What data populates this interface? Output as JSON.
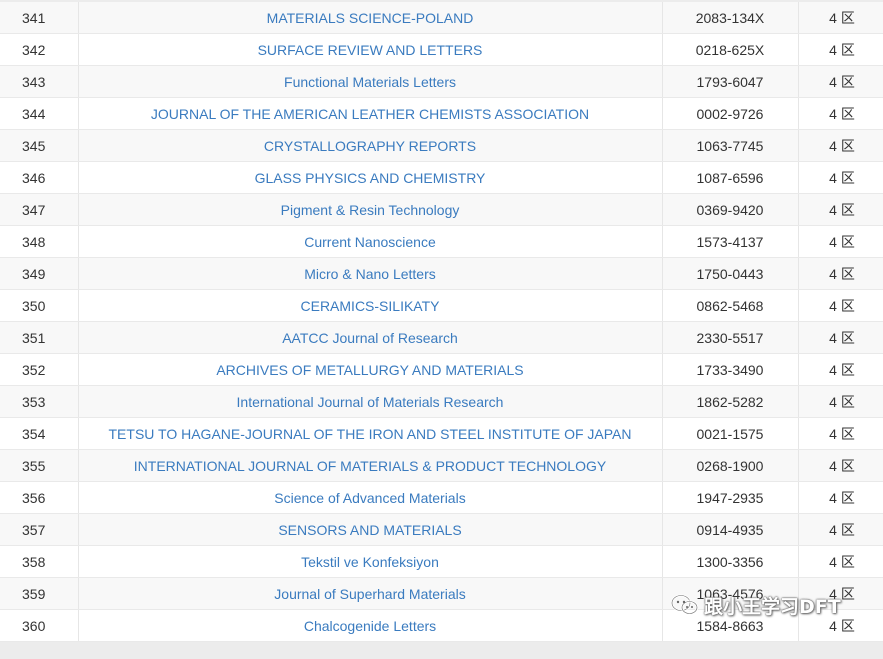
{
  "columns": [
    "",
    "",
    "",
    ""
  ],
  "rows": [
    {
      "num": "341",
      "title": "MATERIALS SCIENCE-POLAND",
      "issn": "2083-134X",
      "zone": "4 区"
    },
    {
      "num": "342",
      "title": "SURFACE REVIEW AND LETTERS",
      "issn": "0218-625X",
      "zone": "4 区"
    },
    {
      "num": "343",
      "title": "Functional Materials Letters",
      "issn": "1793-6047",
      "zone": "4 区"
    },
    {
      "num": "344",
      "title": "JOURNAL OF THE AMERICAN LEATHER CHEMISTS ASSOCIATION",
      "issn": "0002-9726",
      "zone": "4 区"
    },
    {
      "num": "345",
      "title": "CRYSTALLOGRAPHY REPORTS",
      "issn": "1063-7745",
      "zone": "4 区"
    },
    {
      "num": "346",
      "title": "GLASS PHYSICS AND CHEMISTRY",
      "issn": "1087-6596",
      "zone": "4 区"
    },
    {
      "num": "347",
      "title": "Pigment & Resin Technology",
      "issn": "0369-9420",
      "zone": "4 区"
    },
    {
      "num": "348",
      "title": "Current Nanoscience",
      "issn": "1573-4137",
      "zone": "4 区"
    },
    {
      "num": "349",
      "title": "Micro & Nano Letters",
      "issn": "1750-0443",
      "zone": "4 区"
    },
    {
      "num": "350",
      "title": "CERAMICS-SILIKATY",
      "issn": "0862-5468",
      "zone": "4 区"
    },
    {
      "num": "351",
      "title": "AATCC Journal of Research",
      "issn": "2330-5517",
      "zone": "4 区"
    },
    {
      "num": "352",
      "title": "ARCHIVES OF METALLURGY AND MATERIALS",
      "issn": "1733-3490",
      "zone": "4 区"
    },
    {
      "num": "353",
      "title": "International Journal of Materials Research",
      "issn": "1862-5282",
      "zone": "4 区"
    },
    {
      "num": "354",
      "title": "TETSU TO HAGANE-JOURNAL OF THE IRON AND STEEL INSTITUTE OF JAPAN",
      "issn": "0021-1575",
      "zone": "4 区"
    },
    {
      "num": "355",
      "title": "INTERNATIONAL JOURNAL OF MATERIALS & PRODUCT TECHNOLOGY",
      "issn": "0268-1900",
      "zone": "4 区"
    },
    {
      "num": "356",
      "title": "Science of Advanced Materials",
      "issn": "1947-2935",
      "zone": "4 区"
    },
    {
      "num": "357",
      "title": "SENSORS AND MATERIALS",
      "issn": "0914-4935",
      "zone": "4 区"
    },
    {
      "num": "358",
      "title": "Tekstil ve Konfeksiyon",
      "issn": "1300-3356",
      "zone": "4 区"
    },
    {
      "num": "359",
      "title": "Journal of Superhard Materials",
      "issn": "1063-4576",
      "zone": "4 区"
    },
    {
      "num": "360",
      "title": "Chalcogenide Letters",
      "issn": "1584-8663",
      "zone": "4 区"
    }
  ],
  "watermark": {
    "text": "跟小王学习DFT",
    "icon": "wechat-icon"
  },
  "colors": {
    "link": "#3a7bbf",
    "text": "#333333",
    "row_odd": "#f8f8f8",
    "row_even": "#ffffff",
    "background": "#ececec"
  }
}
